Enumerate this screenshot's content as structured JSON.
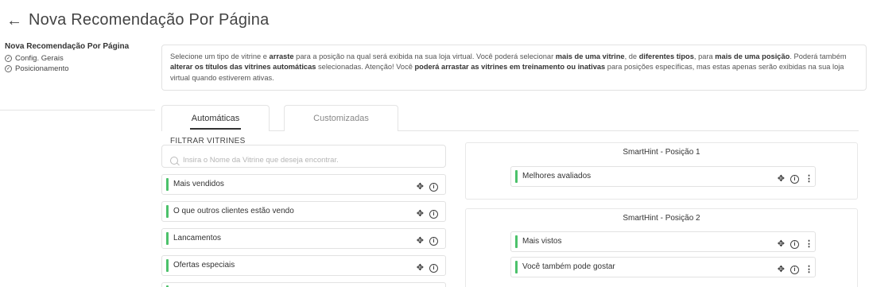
{
  "header": {
    "back_icon": "arrow-left-icon",
    "title": "Nova Recomendação Por Página"
  },
  "sidebar": {
    "title": "Nova Recomendação Por Página",
    "items": [
      {
        "label": "Config. Gerais",
        "icon": "check-circle-icon"
      },
      {
        "label": "Posicionamento",
        "icon": "check-circle-icon"
      }
    ]
  },
  "info": {
    "parts": [
      {
        "t": "Selecione um tipo de vitrine e ",
        "b": false
      },
      {
        "t": "arraste",
        "b": true
      },
      {
        "t": " para a posição na qual será exibida na sua loja virtual. Você poderá selecionar ",
        "b": false
      },
      {
        "t": "mais de uma vitrine",
        "b": true
      },
      {
        "t": ", de ",
        "b": false
      },
      {
        "t": "diferentes tipos",
        "b": true
      },
      {
        "t": ", para ",
        "b": false
      },
      {
        "t": "mais de uma posição",
        "b": true
      },
      {
        "t": ". Poderá também ",
        "b": false
      },
      {
        "t": "alterar os títulos das vitrines automáticas",
        "b": true
      },
      {
        "t": " selecionadas. Atenção! Você ",
        "b": false
      },
      {
        "t": "poderá arrastar as vitrines em treinamento ou inativas",
        "b": true
      },
      {
        "t": " para posições específicas, mas estas apenas serão exibidas na sua loja virtual quando estiverem ativas.",
        "b": false
      }
    ]
  },
  "tabs": {
    "automaticas": "Automáticas",
    "customizadas": "Customizadas"
  },
  "filter": {
    "label": "FILTRAR VITRINES",
    "placeholder": "Insira o Nome da Vitrine que deseja encontrar.",
    "value": ""
  },
  "available_shelves": [
    {
      "label": "Mais vendidos"
    },
    {
      "label": "O que outros clientes estão vendo"
    },
    {
      "label": "Lancamentos"
    },
    {
      "label": "Ofertas especiais"
    }
  ],
  "positions": [
    {
      "title": "SmartHint - Posição 1",
      "items": [
        {
          "label": "Melhores avaliados"
        }
      ]
    },
    {
      "title": "SmartHint - Posição 2",
      "items": [
        {
          "label": "Mais vistos"
        },
        {
          "label": "Você também pode gostar"
        }
      ]
    }
  ],
  "colors": {
    "accent_bar": "#4cc26b",
    "border": "#e2e2e2"
  },
  "icons": {
    "move": "move-arrows-icon",
    "info": "info-circle-icon",
    "more": "more-vertical-icon"
  }
}
